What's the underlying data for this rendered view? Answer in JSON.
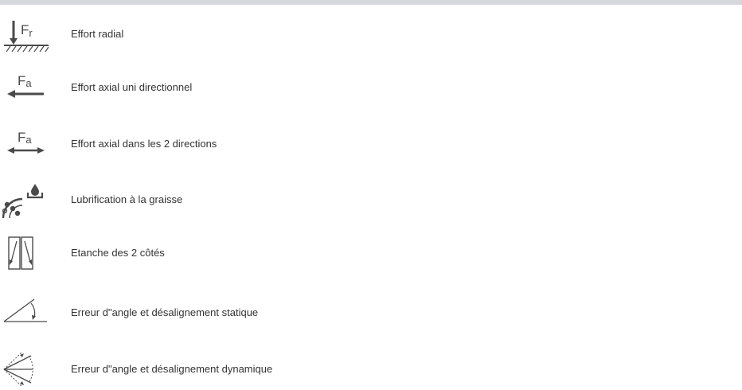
{
  "legend": {
    "items": [
      {
        "icon": "radial-load-icon",
        "label": "Effort radial"
      },
      {
        "icon": "axial-load-one-direction-icon",
        "label": "Effort axial uni directionnel"
      },
      {
        "icon": "axial-load-two-directions-icon",
        "label": "Effort axial dans les 2 directions"
      },
      {
        "icon": "grease-lubrication-icon",
        "label": "Lubrification à la graisse"
      },
      {
        "icon": "sealed-both-sides-icon",
        "label": "Etanche des 2 côtés"
      },
      {
        "icon": "static-misalignment-icon",
        "label": "Erreur d\"angle et désalignement statique"
      },
      {
        "icon": "dynamic-misalignment-icon",
        "label": "Erreur d\"angle et désalignement dynamique"
      }
    ],
    "icon_text": {
      "radial_force": "F",
      "radial_subscript": "r",
      "axial_force": "F",
      "axial_subscript": "a"
    }
  },
  "colors": {
    "text": "#333333",
    "icon": "#4a4a4a",
    "top_bar": "#d5d9dd"
  }
}
